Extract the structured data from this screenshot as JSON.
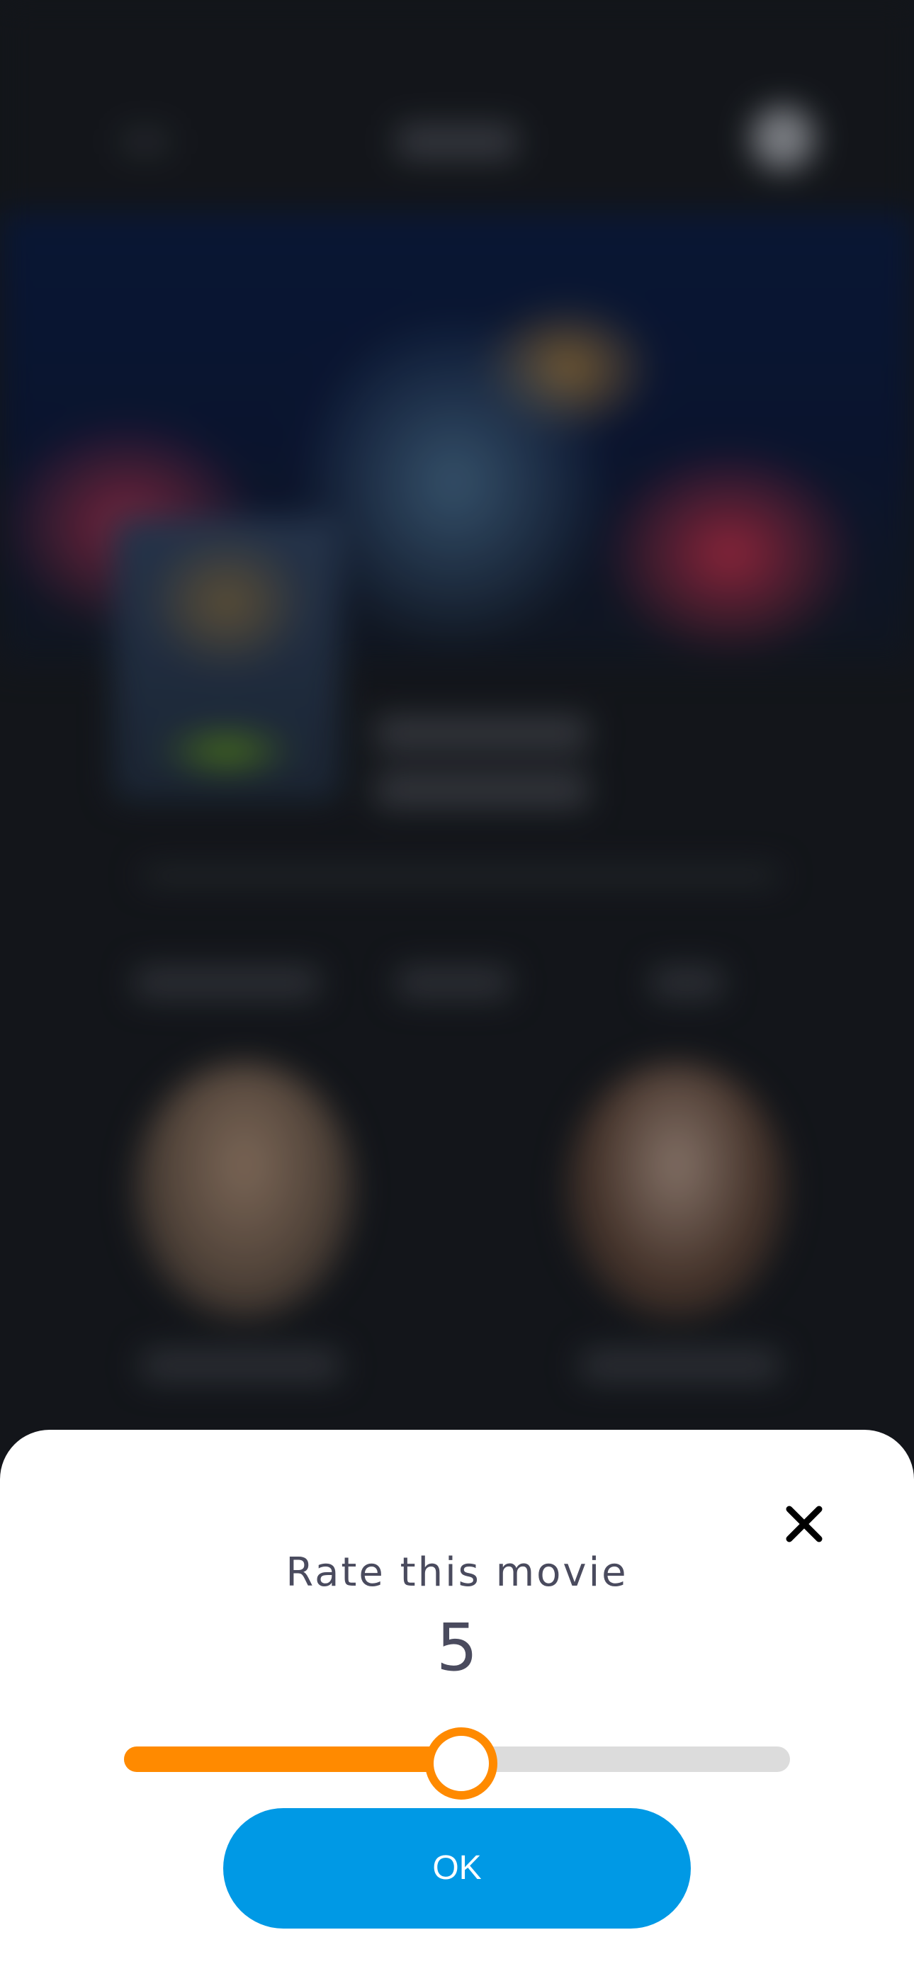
{
  "dialog": {
    "title": "Rate this movie",
    "rating_value": "5",
    "ok_label": "OK",
    "close_icon": "close-icon"
  },
  "slider": {
    "min": 0,
    "max": 10,
    "value": 5,
    "fill_color": "#ff8a00",
    "track_color": "#dcdcdc"
  },
  "colors": {
    "accent": "#ff8a00",
    "primary_button": "#0099e5",
    "text": "#4a4b5e"
  }
}
